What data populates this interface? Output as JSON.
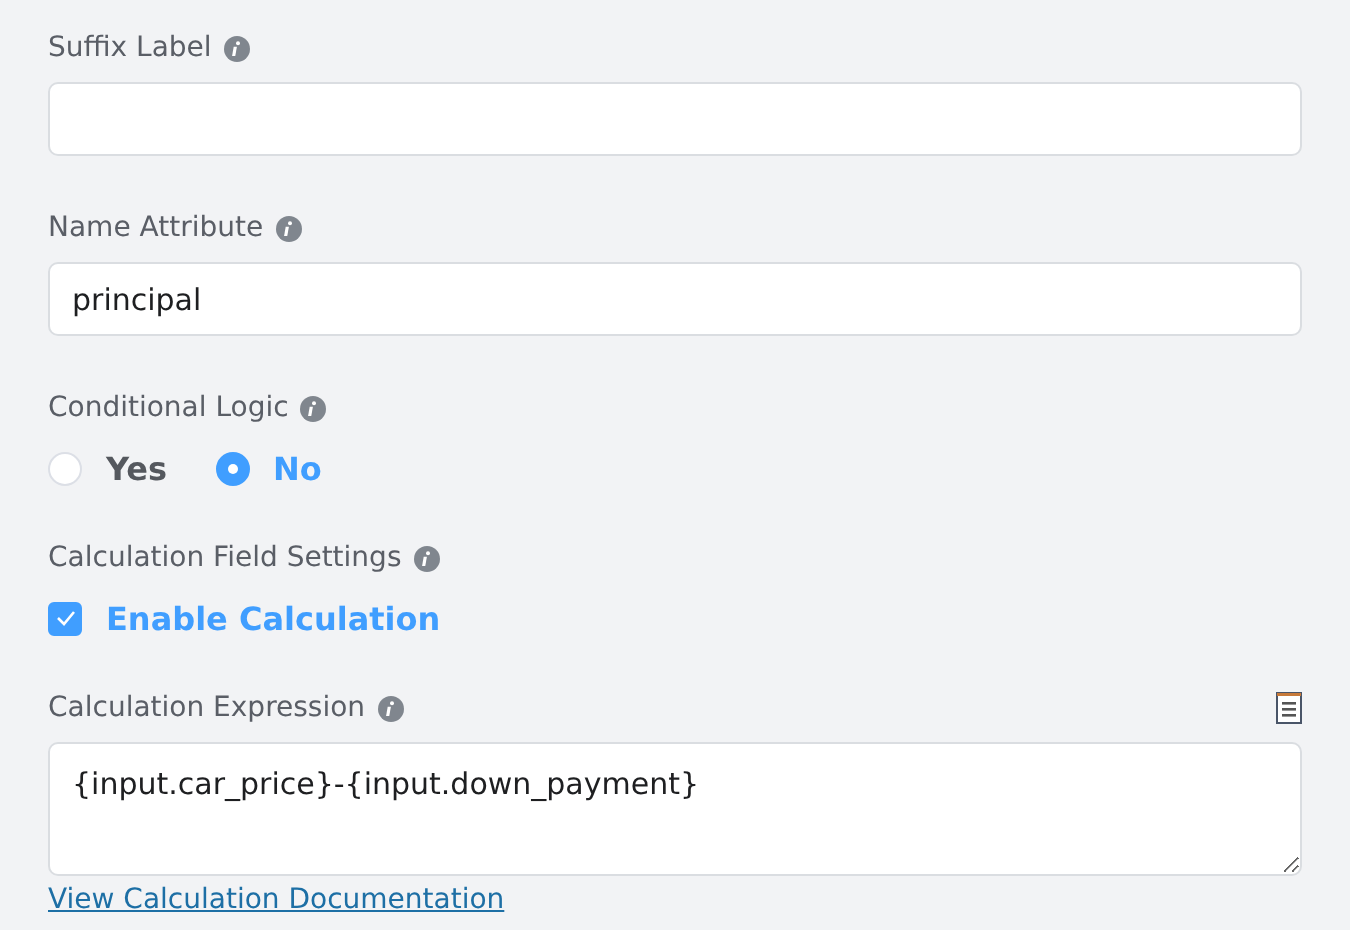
{
  "fields": [
    {
      "kind": "input",
      "label": "Suffix Label"
    },
    {
      "kind": "input",
      "label": "Name Attribute",
      "value": "principal"
    },
    {
      "kind": "radio",
      "label": "Conditional Logic",
      "options": [
        {
          "label": "Yes",
          "selected": false
        },
        {
          "label": "No",
          "selected": true
        }
      ]
    },
    {
      "kind": "checkbox",
      "label": "Calculation Field Settings",
      "option": {
        "label": "Enable Calculation",
        "checked": true
      }
    },
    {
      "kind": "textarea",
      "label": "Calculation Expression",
      "value": "{input.car_price}-{input.down_payment}",
      "link": "View Calculation Documentation"
    }
  ]
}
